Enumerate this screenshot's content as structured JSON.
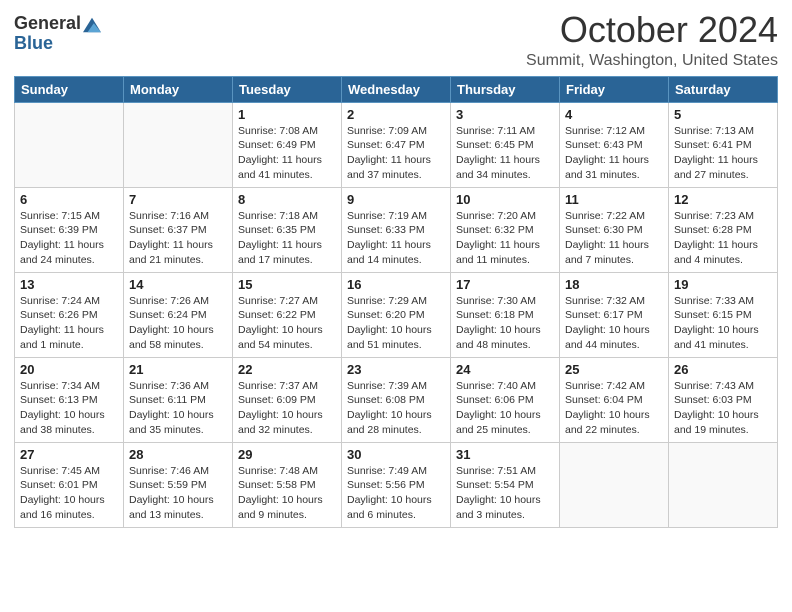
{
  "header": {
    "logo_general": "General",
    "logo_blue": "Blue",
    "title": "October 2024",
    "location": "Summit, Washington, United States"
  },
  "weekdays": [
    "Sunday",
    "Monday",
    "Tuesday",
    "Wednesday",
    "Thursday",
    "Friday",
    "Saturday"
  ],
  "weeks": [
    [
      {
        "day": "",
        "sunrise": "",
        "sunset": "",
        "daylight": ""
      },
      {
        "day": "",
        "sunrise": "",
        "sunset": "",
        "daylight": ""
      },
      {
        "day": "1",
        "sunrise": "Sunrise: 7:08 AM",
        "sunset": "Sunset: 6:49 PM",
        "daylight": "Daylight: 11 hours and 41 minutes."
      },
      {
        "day": "2",
        "sunrise": "Sunrise: 7:09 AM",
        "sunset": "Sunset: 6:47 PM",
        "daylight": "Daylight: 11 hours and 37 minutes."
      },
      {
        "day": "3",
        "sunrise": "Sunrise: 7:11 AM",
        "sunset": "Sunset: 6:45 PM",
        "daylight": "Daylight: 11 hours and 34 minutes."
      },
      {
        "day": "4",
        "sunrise": "Sunrise: 7:12 AM",
        "sunset": "Sunset: 6:43 PM",
        "daylight": "Daylight: 11 hours and 31 minutes."
      },
      {
        "day": "5",
        "sunrise": "Sunrise: 7:13 AM",
        "sunset": "Sunset: 6:41 PM",
        "daylight": "Daylight: 11 hours and 27 minutes."
      }
    ],
    [
      {
        "day": "6",
        "sunrise": "Sunrise: 7:15 AM",
        "sunset": "Sunset: 6:39 PM",
        "daylight": "Daylight: 11 hours and 24 minutes."
      },
      {
        "day": "7",
        "sunrise": "Sunrise: 7:16 AM",
        "sunset": "Sunset: 6:37 PM",
        "daylight": "Daylight: 11 hours and 21 minutes."
      },
      {
        "day": "8",
        "sunrise": "Sunrise: 7:18 AM",
        "sunset": "Sunset: 6:35 PM",
        "daylight": "Daylight: 11 hours and 17 minutes."
      },
      {
        "day": "9",
        "sunrise": "Sunrise: 7:19 AM",
        "sunset": "Sunset: 6:33 PM",
        "daylight": "Daylight: 11 hours and 14 minutes."
      },
      {
        "day": "10",
        "sunrise": "Sunrise: 7:20 AM",
        "sunset": "Sunset: 6:32 PM",
        "daylight": "Daylight: 11 hours and 11 minutes."
      },
      {
        "day": "11",
        "sunrise": "Sunrise: 7:22 AM",
        "sunset": "Sunset: 6:30 PM",
        "daylight": "Daylight: 11 hours and 7 minutes."
      },
      {
        "day": "12",
        "sunrise": "Sunrise: 7:23 AM",
        "sunset": "Sunset: 6:28 PM",
        "daylight": "Daylight: 11 hours and 4 minutes."
      }
    ],
    [
      {
        "day": "13",
        "sunrise": "Sunrise: 7:24 AM",
        "sunset": "Sunset: 6:26 PM",
        "daylight": "Daylight: 11 hours and 1 minute."
      },
      {
        "day": "14",
        "sunrise": "Sunrise: 7:26 AM",
        "sunset": "Sunset: 6:24 PM",
        "daylight": "Daylight: 10 hours and 58 minutes."
      },
      {
        "day": "15",
        "sunrise": "Sunrise: 7:27 AM",
        "sunset": "Sunset: 6:22 PM",
        "daylight": "Daylight: 10 hours and 54 minutes."
      },
      {
        "day": "16",
        "sunrise": "Sunrise: 7:29 AM",
        "sunset": "Sunset: 6:20 PM",
        "daylight": "Daylight: 10 hours and 51 minutes."
      },
      {
        "day": "17",
        "sunrise": "Sunrise: 7:30 AM",
        "sunset": "Sunset: 6:18 PM",
        "daylight": "Daylight: 10 hours and 48 minutes."
      },
      {
        "day": "18",
        "sunrise": "Sunrise: 7:32 AM",
        "sunset": "Sunset: 6:17 PM",
        "daylight": "Daylight: 10 hours and 44 minutes."
      },
      {
        "day": "19",
        "sunrise": "Sunrise: 7:33 AM",
        "sunset": "Sunset: 6:15 PM",
        "daylight": "Daylight: 10 hours and 41 minutes."
      }
    ],
    [
      {
        "day": "20",
        "sunrise": "Sunrise: 7:34 AM",
        "sunset": "Sunset: 6:13 PM",
        "daylight": "Daylight: 10 hours and 38 minutes."
      },
      {
        "day": "21",
        "sunrise": "Sunrise: 7:36 AM",
        "sunset": "Sunset: 6:11 PM",
        "daylight": "Daylight: 10 hours and 35 minutes."
      },
      {
        "day": "22",
        "sunrise": "Sunrise: 7:37 AM",
        "sunset": "Sunset: 6:09 PM",
        "daylight": "Daylight: 10 hours and 32 minutes."
      },
      {
        "day": "23",
        "sunrise": "Sunrise: 7:39 AM",
        "sunset": "Sunset: 6:08 PM",
        "daylight": "Daylight: 10 hours and 28 minutes."
      },
      {
        "day": "24",
        "sunrise": "Sunrise: 7:40 AM",
        "sunset": "Sunset: 6:06 PM",
        "daylight": "Daylight: 10 hours and 25 minutes."
      },
      {
        "day": "25",
        "sunrise": "Sunrise: 7:42 AM",
        "sunset": "Sunset: 6:04 PM",
        "daylight": "Daylight: 10 hours and 22 minutes."
      },
      {
        "day": "26",
        "sunrise": "Sunrise: 7:43 AM",
        "sunset": "Sunset: 6:03 PM",
        "daylight": "Daylight: 10 hours and 19 minutes."
      }
    ],
    [
      {
        "day": "27",
        "sunrise": "Sunrise: 7:45 AM",
        "sunset": "Sunset: 6:01 PM",
        "daylight": "Daylight: 10 hours and 16 minutes."
      },
      {
        "day": "28",
        "sunrise": "Sunrise: 7:46 AM",
        "sunset": "Sunset: 5:59 PM",
        "daylight": "Daylight: 10 hours and 13 minutes."
      },
      {
        "day": "29",
        "sunrise": "Sunrise: 7:48 AM",
        "sunset": "Sunset: 5:58 PM",
        "daylight": "Daylight: 10 hours and 9 minutes."
      },
      {
        "day": "30",
        "sunrise": "Sunrise: 7:49 AM",
        "sunset": "Sunset: 5:56 PM",
        "daylight": "Daylight: 10 hours and 6 minutes."
      },
      {
        "day": "31",
        "sunrise": "Sunrise: 7:51 AM",
        "sunset": "Sunset: 5:54 PM",
        "daylight": "Daylight: 10 hours and 3 minutes."
      },
      {
        "day": "",
        "sunrise": "",
        "sunset": "",
        "daylight": ""
      },
      {
        "day": "",
        "sunrise": "",
        "sunset": "",
        "daylight": ""
      }
    ]
  ]
}
